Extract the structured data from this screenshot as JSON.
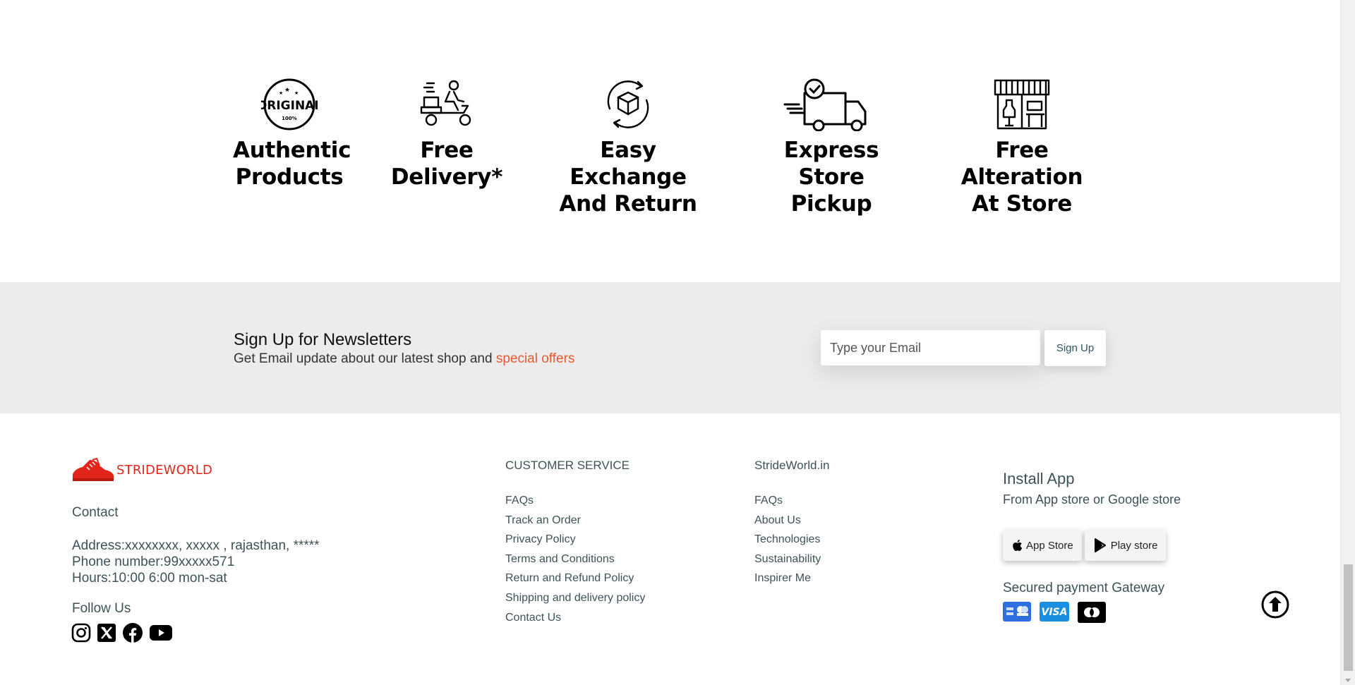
{
  "features": [
    {
      "icon": "original-badge-icon",
      "line1": "Authentic",
      "line2": "Products"
    },
    {
      "icon": "delivery-scooter-icon",
      "line1": "Free",
      "line2": "Delivery*"
    },
    {
      "icon": "exchange-box-icon",
      "line1": "Easy Exchange",
      "line2": "And Return"
    },
    {
      "icon": "delivery-truck-icon",
      "line1": "Express",
      "line2": "Store Pickup"
    },
    {
      "icon": "tailor-store-icon",
      "line1": "Free Alteration",
      "line2": "At Store"
    }
  ],
  "badge": {
    "text": "ORIGINAL",
    "sub": "100%"
  },
  "newsletter": {
    "heading": "Sign Up for Newsletters",
    "sub_text": "Get Email update about our latest shop and ",
    "sub_accent": "special offers",
    "email_placeholder": "Type your Email",
    "button_label": "Sign Up"
  },
  "footer": {
    "brand": "STRIDEWORLD",
    "contact_title": "Contact",
    "address": "Address:xxxxxxxx, xxxxx , rajasthan, *****",
    "phone": "Phone number:99xxxxx571",
    "hours": "Hours:10:00 6:00 mon-sat",
    "follow_title": "Follow Us",
    "socials": [
      "instagram-icon",
      "x-twitter-icon",
      "facebook-icon",
      "youtube-icon"
    ],
    "customer_service": {
      "title": "CUSTOMER SERVICE",
      "links": [
        "FAQs",
        "Track an Order",
        "Privacy Policy",
        "Terms and Conditions",
        "Return and Refund Policy",
        "Shipping and delivery policy",
        "Contact Us"
      ]
    },
    "strideworld": {
      "title": "StrideWorld.in",
      "links": [
        "FAQs",
        "About Us",
        "Technologies",
        "Sustainability",
        "Inspirer Me"
      ]
    },
    "install_app": {
      "title": "Install App",
      "sub": "From App store or Google store",
      "app_store": "App Store",
      "play_store": "Play store"
    },
    "payment": {
      "title": "Secured payment Gateway",
      "methods": [
        "card-icon",
        "visa-icon",
        "mastercard-icon"
      ],
      "visa_text": "VISA"
    }
  },
  "colors": {
    "accent": "#e8582f",
    "brand": "#e1251b",
    "footer_text": "#3e5258",
    "newsletter_bg": "#ececec"
  }
}
